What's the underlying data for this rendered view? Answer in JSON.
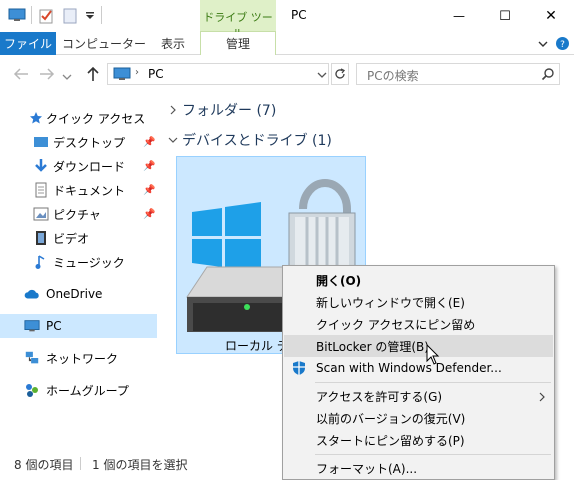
{
  "window": {
    "title": "PC",
    "contextual_tab_group": "ドライブ ツール",
    "minimize_glyph": "—",
    "maximize_glyph": "☐",
    "close_glyph": "✕"
  },
  "ribbon": {
    "tabs": [
      "ファイル",
      "コンピューター",
      "表示",
      "管理"
    ]
  },
  "address": {
    "path": "PC",
    "search_placeholder": "PCの検索"
  },
  "sidebar": {
    "items": [
      {
        "label": "クイック アクセス",
        "icon": "star-icon"
      },
      {
        "label": "デスクトップ",
        "icon": "desktop-folder-icon"
      },
      {
        "label": "ダウンロード",
        "icon": "download-icon"
      },
      {
        "label": "ドキュメント",
        "icon": "document-icon"
      },
      {
        "label": "ピクチャ",
        "icon": "pictures-icon"
      },
      {
        "label": "ビデオ",
        "icon": "video-icon"
      },
      {
        "label": "ミュージック",
        "icon": "music-icon"
      },
      {
        "label": "OneDrive",
        "icon": "cloud-icon"
      },
      {
        "label": "PC",
        "icon": "computer-icon"
      },
      {
        "label": "ネットワーク",
        "icon": "network-icon"
      },
      {
        "label": "ホームグループ",
        "icon": "homegroup-icon"
      }
    ]
  },
  "main": {
    "groups": [
      {
        "label": "フォルダー (7)",
        "expanded": false
      },
      {
        "label": "デバイスとドライブ (1)",
        "expanded": true
      }
    ],
    "drive_label": "ローカル ディ"
  },
  "status": {
    "item_count": "8 個の項目",
    "selected": "1 個の項目を選択"
  },
  "context_menu": {
    "items": [
      {
        "label": "開く(O)",
        "bold": true
      },
      {
        "label": "新しいウィンドウで開く(E)"
      },
      {
        "label": "クイック アクセスにピン留め"
      },
      {
        "label": "BitLocker の管理(B)",
        "highlighted": true
      },
      {
        "label": "Scan with Windows Defender..."
      },
      {
        "label": "アクセスを許可する(G)",
        "submenu": true
      },
      {
        "label": "以前のバージョンの復元(V)"
      },
      {
        "label": "スタートにピン留めする(P)"
      },
      {
        "label": "フォーマット(A)..."
      }
    ]
  },
  "colors": {
    "accent": "#1979ca",
    "selection": "#cce8ff",
    "contextual_tab": "#dff0c8"
  }
}
